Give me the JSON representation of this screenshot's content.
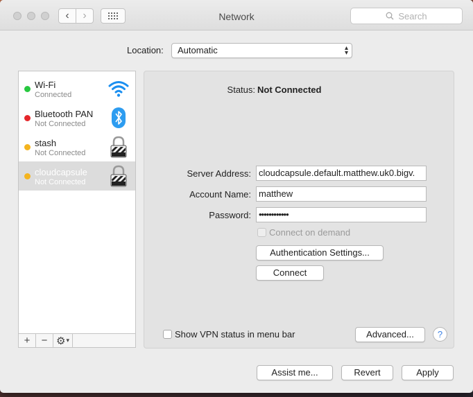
{
  "window": {
    "title": "Network"
  },
  "toolbar": {
    "search_placeholder": "Search"
  },
  "location": {
    "label": "Location:",
    "value": "Automatic"
  },
  "services": [
    {
      "name": "Wi-Fi",
      "status": "Connected",
      "dot_color": "#28c840",
      "icon": "wifi-icon"
    },
    {
      "name": "Bluetooth PAN",
      "status": "Not Connected",
      "dot_color": "#e5262a",
      "icon": "bluetooth-icon"
    },
    {
      "name": "stash",
      "status": "Not Connected",
      "dot_color": "#f4b41f",
      "icon": "lock-icon"
    },
    {
      "name": "cloudcapsule",
      "status": "Not Connected",
      "dot_color": "#f4b41f",
      "icon": "lock-icon",
      "selected": true
    }
  ],
  "sidebar_controls": {
    "add": "+",
    "remove": "−",
    "gear": "⚙"
  },
  "detail": {
    "status_label": "Status:",
    "status_value": "Not Connected",
    "server_label": "Server Address:",
    "server_value": "cloudcapsule.default.matthew.uk0.bigv.",
    "account_label": "Account Name:",
    "account_value": "matthew",
    "password_label": "Password:",
    "password_value": "••••••••••••",
    "connect_on_demand": "Connect on demand",
    "auth_button": "Authentication Settings...",
    "connect_button": "Connect",
    "show_vpn_label": "Show VPN status in menu bar",
    "advanced_button": "Advanced...",
    "help": "?"
  },
  "footer": {
    "assist": "Assist me...",
    "revert": "Revert",
    "apply": "Apply"
  }
}
